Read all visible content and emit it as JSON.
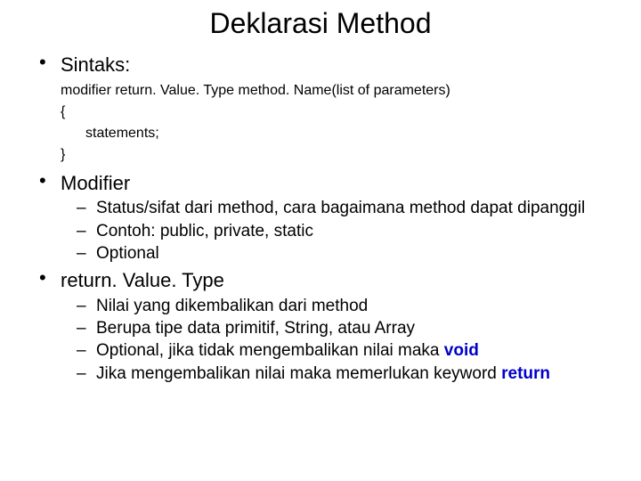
{
  "title": "Deklarasi Method",
  "sections": {
    "sintaks": {
      "head": "Sintaks:",
      "line": "modifier return. Value. Type method. Name(list of parameters)",
      "open": "{",
      "stmt": "statements;",
      "close": "}"
    },
    "modifier": {
      "head": "Modifier",
      "items": [
        "Status/sifat dari method, cara bagaimana method dapat dipanggil",
        "Contoh: public, private, static",
        "Optional"
      ]
    },
    "rvt": {
      "head": "return. Value. Type",
      "items": [
        {
          "pre": "Nilai yang dikembalikan dari method"
        },
        {
          "pre": "Berupa tipe data primitif, String, atau Array"
        },
        {
          "pre": "Optional, jika tidak mengembalikan nilai maka ",
          "kw": "void",
          "post": ""
        },
        {
          "pre": "Jika mengembalikan nilai maka memerlukan keyword ",
          "kw": "return",
          "post": ""
        }
      ]
    }
  }
}
